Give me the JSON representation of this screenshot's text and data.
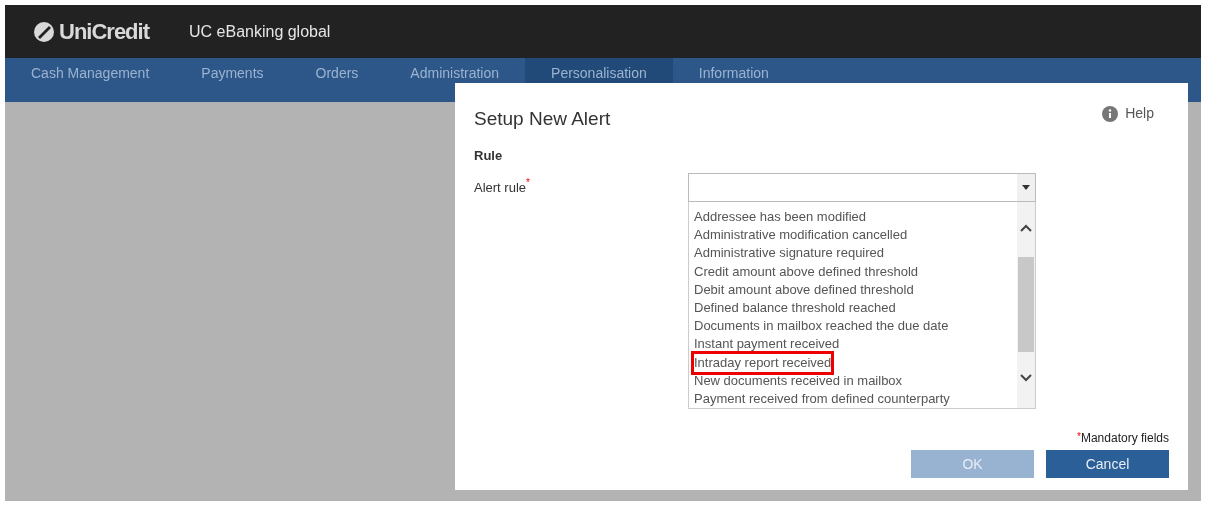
{
  "header": {
    "logo": "UniCredit",
    "app_title": "UC eBanking global"
  },
  "nav": [
    {
      "label": "Cash Management",
      "selected": false
    },
    {
      "label": "Payments",
      "selected": false
    },
    {
      "label": "Orders",
      "selected": false
    },
    {
      "label": "Administration",
      "selected": false
    },
    {
      "label": "Personalisation",
      "selected": true
    },
    {
      "label": "Information",
      "selected": false
    }
  ],
  "dialog": {
    "title": "Setup New Alert",
    "help": "Help",
    "section": "Rule",
    "field_label": "Alert rule",
    "required_mark": "*",
    "options": [
      {
        "label": "Addressee has been modified",
        "highlighted": false
      },
      {
        "label": "Administrative modification cancelled",
        "highlighted": false
      },
      {
        "label": "Administrative signature required",
        "highlighted": false
      },
      {
        "label": "Credit amount above defined threshold",
        "highlighted": false
      },
      {
        "label": "Debit amount above defined threshold",
        "highlighted": false
      },
      {
        "label": "Defined balance threshold reached",
        "highlighted": false
      },
      {
        "label": "Documents in mailbox reached the due date",
        "highlighted": false
      },
      {
        "label": "Instant payment received",
        "highlighted": false
      },
      {
        "label": "Intraday report received",
        "highlighted": true
      },
      {
        "label": "New documents received in mailbox",
        "highlighted": false
      },
      {
        "label": "Payment received from defined counterparty",
        "highlighted": false
      }
    ],
    "mandatory_mark": "*",
    "mandatory_note": "Mandatory fields",
    "buttons": [
      {
        "label": "OK",
        "disabled": true
      },
      {
        "label": "Cancel",
        "disabled": false
      }
    ]
  }
}
